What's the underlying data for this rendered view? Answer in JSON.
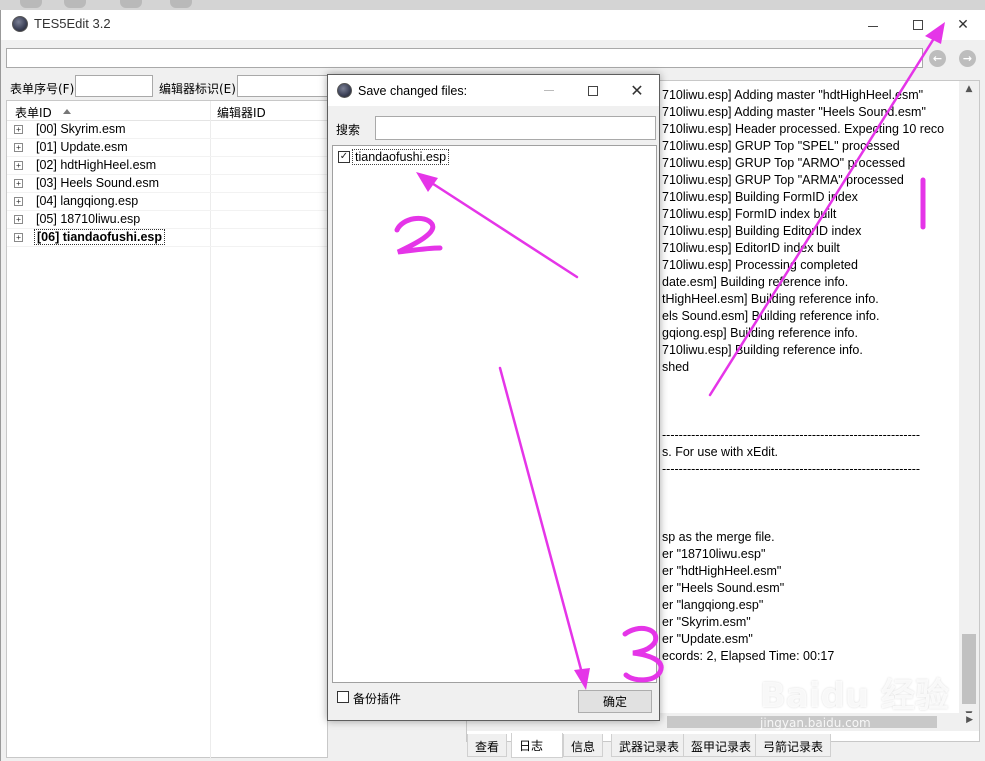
{
  "window": {
    "title": "TES5Edit 3.2",
    "minimize_glyph": "—",
    "maximize_glyph": "☐",
    "close_glyph": "✕"
  },
  "nav": {
    "back_glyph": "←",
    "forward_glyph": "→"
  },
  "filters": {
    "form_id_label": "表单序号(F)",
    "editor_id_label": "编辑器标识(E)"
  },
  "tree": {
    "col_form_id": "表单ID",
    "col_editor_id": "编辑器ID",
    "expander_glyph": "+",
    "rows": [
      {
        "label": "[00] Skyrim.esm"
      },
      {
        "label": "[01] Update.esm"
      },
      {
        "label": "[02] hdtHighHeel.esm"
      },
      {
        "label": "[03] Heels Sound.esm"
      },
      {
        "label": "[04] langqiong.esp"
      },
      {
        "label": "[05] 18710liwu.esp"
      },
      {
        "label": "[06] tiandaofushi.esp"
      }
    ]
  },
  "log": {
    "lines": [
      "710liwu.esp] Adding master \"hdtHighHeel.esm\"",
      "710liwu.esp] Adding master \"Heels Sound.esm\"",
      "710liwu.esp] Header processed. Expecting 10 reco",
      "710liwu.esp] GRUP Top \"SPEL\" processed",
      "710liwu.esp] GRUP Top \"ARMO\" processed",
      "710liwu.esp] GRUP Top \"ARMA\" processed",
      "710liwu.esp] Building FormID index",
      "710liwu.esp] FormID index built",
      "710liwu.esp] Building EditorID index",
      "710liwu.esp] EditorID index built",
      "710liwu.esp] Processing completed",
      "date.esm] Building reference info.",
      "tHighHeel.esm] Building reference info.",
      "els Sound.esm] Building reference info.",
      "gqiong.esp] Building reference info.",
      "710liwu.esp] Building reference info.",
      "shed",
      "",
      "",
      "",
      "--------------------------------------------------------------",
      "s.  For use with xEdit.",
      "--------------------------------------------------------------",
      "",
      "",
      "",
      "sp as the merge file.",
      "er \"18710liwu.esp\"",
      "er \"hdtHighHeel.esm\"",
      "er \"Heels Sound.esm\"",
      "er \"langqiong.esp\"",
      "er \"Skyrim.esm\"",
      "er \"Update.esm\"",
      "ecords: 2, Elapsed Time: 00:17"
    ]
  },
  "tabs": [
    {
      "label": "查看"
    },
    {
      "label": "日志"
    },
    {
      "label": "信息"
    },
    {
      "label": "武器记录表"
    },
    {
      "label": "盔甲记录表"
    },
    {
      "label": "弓箭记录表"
    }
  ],
  "dialog": {
    "title": "Save changed files:",
    "close_glyph": "✕",
    "search_label": "搜索",
    "search_value": "",
    "files": [
      {
        "name": "tiandaofushi.esp",
        "checked": "✓"
      }
    ],
    "backup_label": "备份插件",
    "ok_label": "确定"
  },
  "annotations": {
    "color": "#e535e8",
    "marks": [
      "1",
      "2",
      "3"
    ]
  },
  "watermark": {
    "text": "Baidu 经验",
    "sub": "jingyan.baidu.com"
  }
}
